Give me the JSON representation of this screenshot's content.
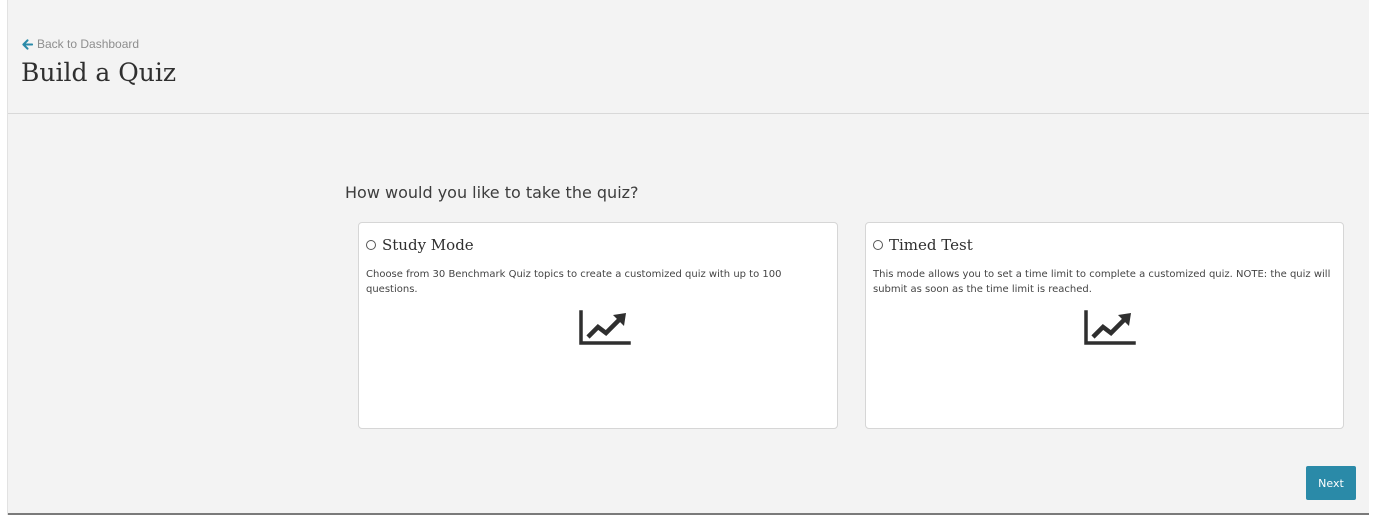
{
  "header": {
    "back_link_label": "Back to Dashboard",
    "title": "Build a Quiz"
  },
  "main": {
    "question": "How would you like to take the quiz?",
    "options": [
      {
        "title": "Study Mode",
        "description": "Choose from 30 Benchmark Quiz topics to create a customized quiz with up to 100 questions.",
        "icon": "line-chart-icon",
        "selected": false
      },
      {
        "title": "Timed Test",
        "description": "This mode allows you to set a time limit to complete a customized quiz. NOTE: the quiz will submit as soon as the time limit is reached.",
        "icon": "line-chart-icon",
        "selected": false
      }
    ]
  },
  "footer": {
    "next_label": "Next"
  },
  "colors": {
    "accent": "#2a8aa8",
    "background": "#f3f3f3",
    "card_background": "#ffffff",
    "icon": "#2f2f2f"
  }
}
